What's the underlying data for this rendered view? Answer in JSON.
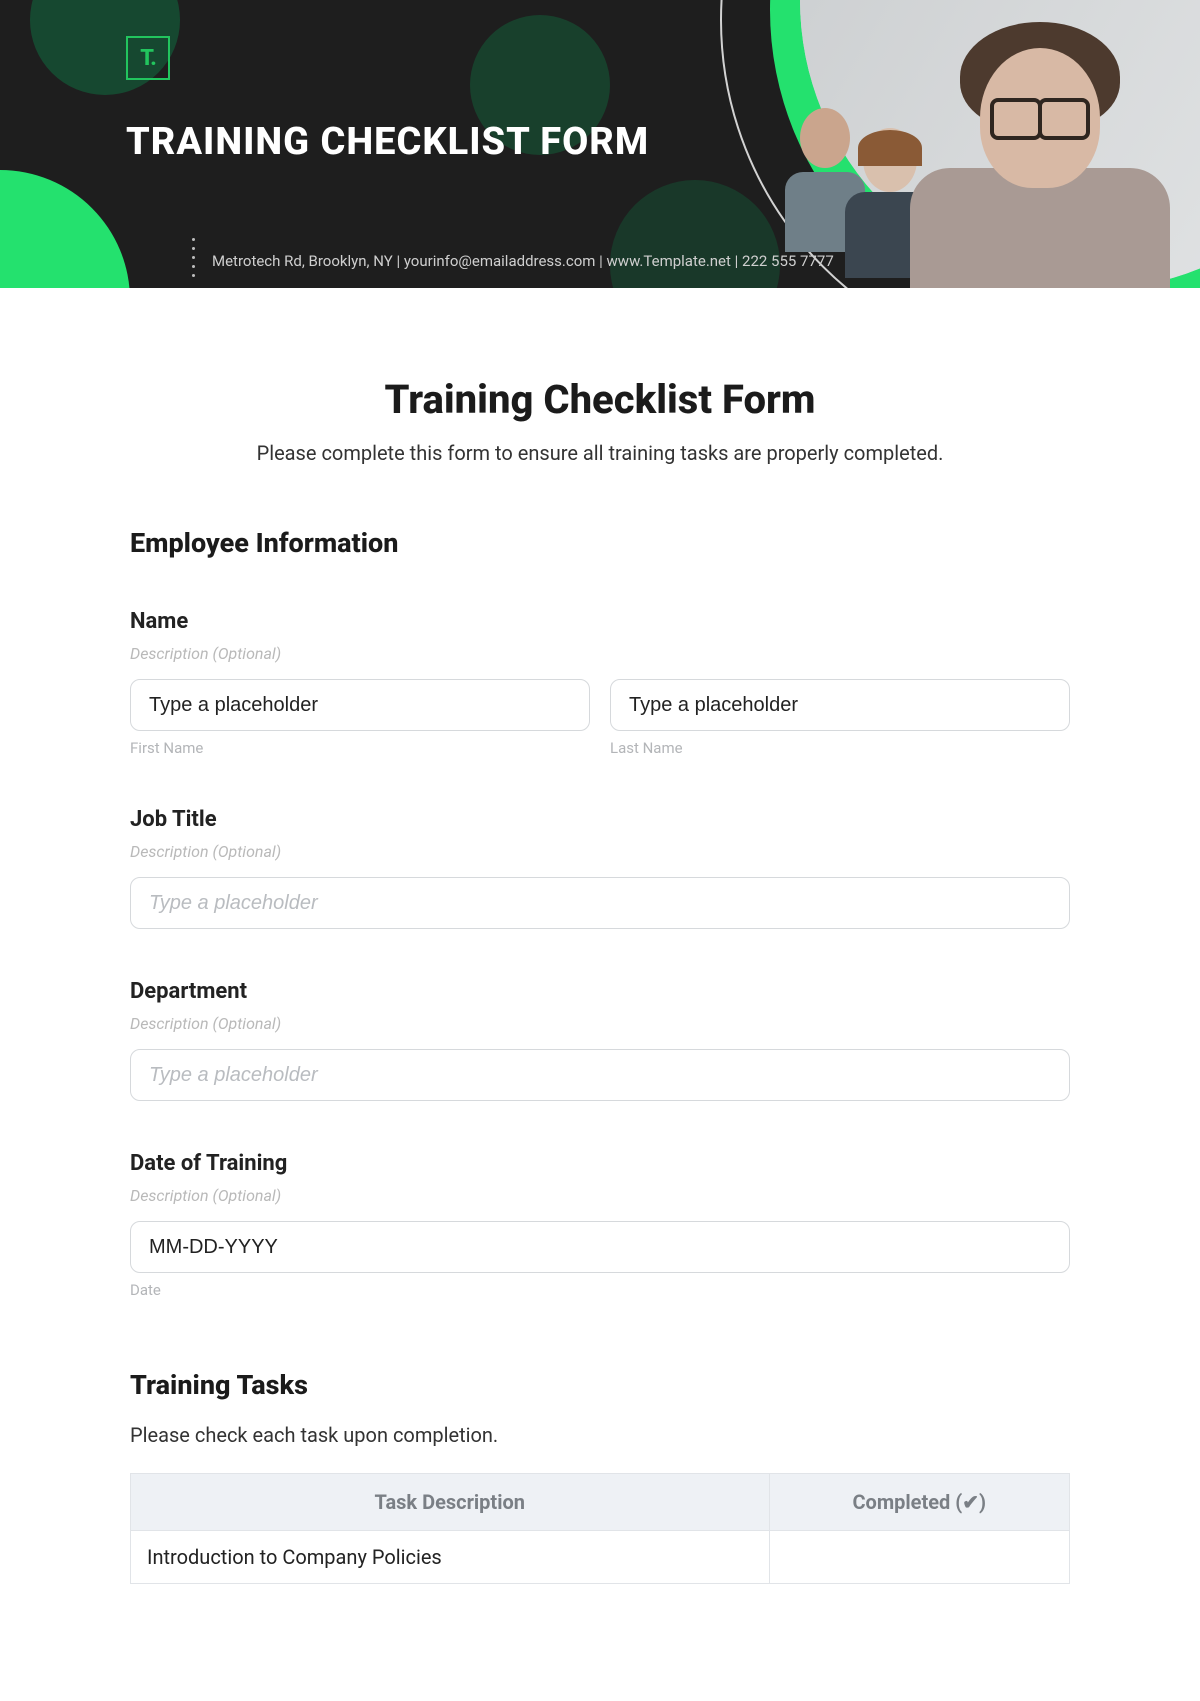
{
  "banner": {
    "logo_text": "T.",
    "title": "TRAINING CHECKLIST FORM",
    "contact": "Metrotech Rd, Brooklyn, NY  |  yourinfo@emailaddress.com  |  www.Template.net  |  222 555 7777"
  },
  "page": {
    "title": "Training Checklist Form",
    "subtitle": "Please complete this form to ensure all training tasks are properly completed."
  },
  "section_employee": "Employee Information",
  "section_tasks": "Training Tasks",
  "name": {
    "label": "Name",
    "desc": "Description (Optional)",
    "first_placeholder": "Type a placeholder",
    "last_placeholder": "Type a placeholder",
    "first_sub": "First Name",
    "last_sub": "Last Name"
  },
  "job": {
    "label": "Job Title",
    "desc": "Description (Optional)",
    "placeholder": "Type a placeholder"
  },
  "dept": {
    "label": "Department",
    "desc": "Description (Optional)",
    "placeholder": "Type a placeholder"
  },
  "date": {
    "label": "Date of Training",
    "desc": "Description (Optional)",
    "placeholder": "MM-DD-YYYY",
    "sub": "Date"
  },
  "tasks": {
    "intro": "Please check each task upon completion.",
    "col_task": "Task Description",
    "col_done": "Completed (✔)",
    "rows": [
      "Introduction to Company Policies"
    ]
  }
}
